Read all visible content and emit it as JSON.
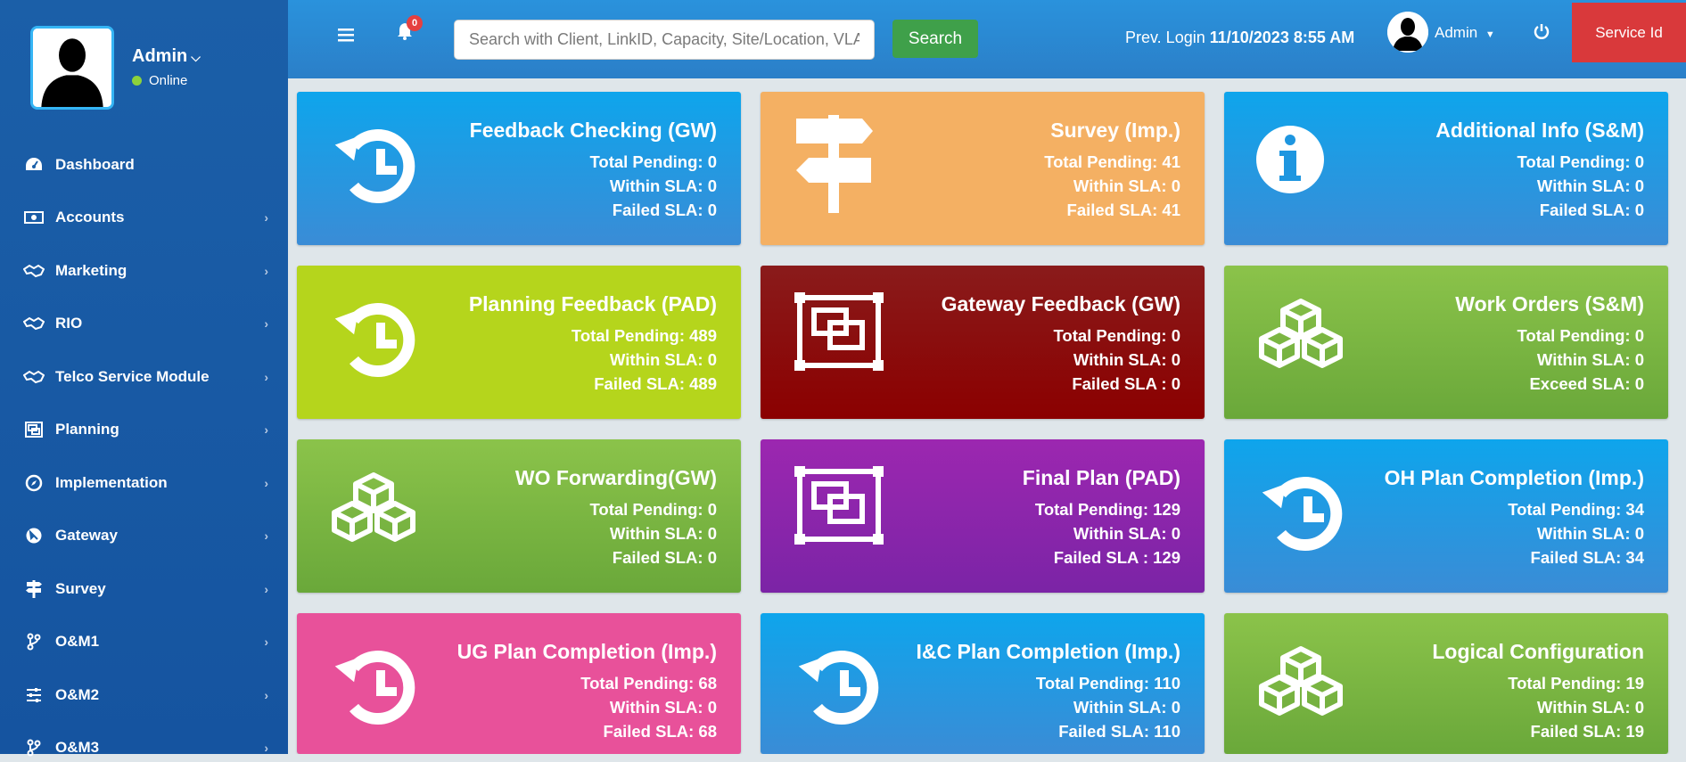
{
  "sidebar": {
    "user": {
      "name": "Admin",
      "status": "Online"
    },
    "items": [
      {
        "label": "Dashboard",
        "icon": "dashboard-icon"
      },
      {
        "label": "Accounts",
        "icon": "money-icon"
      },
      {
        "label": "Marketing",
        "icon": "handshake-icon"
      },
      {
        "label": "RIO",
        "icon": "handshake-icon"
      },
      {
        "label": "Telco Service Module",
        "icon": "handshake-icon"
      },
      {
        "label": "Planning",
        "icon": "object-group-icon"
      },
      {
        "label": "Implementation",
        "icon": "compass-icon"
      },
      {
        "label": "Gateway",
        "icon": "satellite-icon"
      },
      {
        "label": "Survey",
        "icon": "signpost-icon"
      },
      {
        "label": "O&M1",
        "icon": "branch-icon"
      },
      {
        "label": "O&M2",
        "icon": "sliders-icon"
      },
      {
        "label": "O&M3",
        "icon": "branch-icon"
      }
    ]
  },
  "topbar": {
    "notification_count": "0",
    "search_placeholder": "Search with Client, LinkID, Capacity, Site/Location, VLAN",
    "search_button": "Search",
    "prev_login_label": "Prev. Login",
    "prev_login_value": "11/10/2023 8:55 AM",
    "user_label": "Admin",
    "service_button": "Service Id"
  },
  "cards": [
    {
      "title": "Feedback Checking (GW)",
      "l1": "Total Pending: 0",
      "l2": "Within SLA: 0",
      "l3": "Failed SLA: 0",
      "color": "#0ea5ec",
      "icon": "history-icon"
    },
    {
      "title": "Survey (Imp.)",
      "l1": "Total Pending: 41",
      "l2": "Within SLA: 0",
      "l3": "Failed SLA: 41",
      "color": "#f4b063",
      "icon": "signpost-icon"
    },
    {
      "title": "Additional Info (S&M)",
      "l1": "Total Pending: 0",
      "l2": "Within SLA: 0",
      "l3": "Failed SLA: 0",
      "color": "#0ea5ec",
      "icon": "info-icon"
    },
    {
      "title": "Planning Feedback (PAD)",
      "l1": "Total Pending: 489",
      "l2": "Within SLA: 0",
      "l3": "Failed SLA: 489",
      "color": "#b5d51c",
      "icon": "history-icon"
    },
    {
      "title": "Gateway Feedback (GW)",
      "l1": "Total Pending: 0",
      "l2": "Within SLA: 0",
      "l3": "Failed SLA : 0",
      "color": "#8b0000",
      "icon": "object-group-icon"
    },
    {
      "title": "Work Orders (S&M)",
      "l1": "Total Pending: 0",
      "l2": "Within SLA: 0",
      "l3": "Exceed SLA: 0",
      "color": "#7cb342",
      "icon": "cubes-icon"
    },
    {
      "title": "WO Forwarding(GW)",
      "l1": "Total Pending: 0",
      "l2": "Within SLA: 0",
      "l3": "Failed SLA: 0",
      "color": "#7cb342",
      "icon": "cubes-icon"
    },
    {
      "title": "Final Plan (PAD)",
      "l1": "Total Pending: 129",
      "l2": "Within SLA: 0",
      "l3": "Failed SLA : 129",
      "color": "#9c27b0",
      "icon": "object-group-icon"
    },
    {
      "title": "OH Plan Completion (Imp.)",
      "l1": "Total Pending: 34",
      "l2": "Within SLA: 0",
      "l3": "Failed SLA: 34",
      "color": "#0ea5ec",
      "icon": "history-icon"
    },
    {
      "title": "UG Plan Completion (Imp.)",
      "l1": "Total Pending: 68",
      "l2": "Within SLA: 0",
      "l3": "Failed SLA: 68",
      "color": "#e8519a",
      "icon": "history-icon"
    },
    {
      "title": "I&C Plan Completion (Imp.)",
      "l1": "Total Pending: 110",
      "l2": "Within SLA: 0",
      "l3": "Failed SLA: 110",
      "color": "#0ea5ec",
      "icon": "history-icon"
    },
    {
      "title": "Logical Configuration",
      "l1": "Total Pending: 19",
      "l2": "Within SLA: 0",
      "l3": "Failed SLA: 19",
      "color": "#7cb342",
      "icon": "cubes-icon"
    }
  ]
}
